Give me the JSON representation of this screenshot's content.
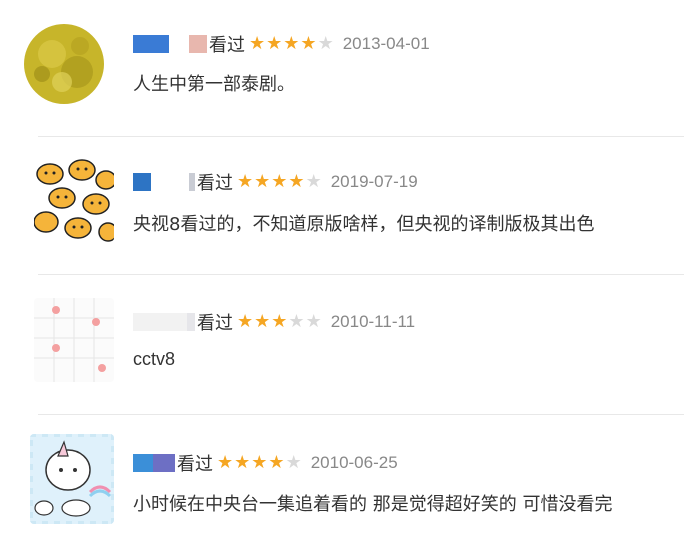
{
  "colors": {
    "star_filled": "#f5a623",
    "star_empty": "#d9d9d9",
    "date": "#888888",
    "text": "#333333",
    "divider": "#e8e8e8"
  },
  "star_glyph": "★",
  "reviews": [
    {
      "status": "看过",
      "rating": 4,
      "max_rating": 5,
      "date": "2013-04-01",
      "content": "人生中第一部泰剧。",
      "username_colors": [
        "#3a7bd5",
        "#e8b7ae"
      ]
    },
    {
      "status": "看过",
      "rating": 4,
      "max_rating": 5,
      "date": "2019-07-19",
      "content": "央视8看过的，不知道原版啥样，但央视的译制版极其出色",
      "username_colors": [
        "#2d74c4",
        "#c9ccd4"
      ]
    },
    {
      "status": "看过",
      "rating": 3,
      "max_rating": 5,
      "date": "2010-11-11",
      "content": "cctv8",
      "username_colors": [
        "#f2f2f2",
        "#e6e6ea"
      ]
    },
    {
      "status": "看过",
      "rating": 4,
      "max_rating": 5,
      "date": "2010-06-25",
      "content": "小时候在中央台一集追着看的 那是觉得超好笑的 可惜没看完",
      "username_colors": [
        "#3b8fd8",
        "#6d6fc4"
      ]
    }
  ]
}
